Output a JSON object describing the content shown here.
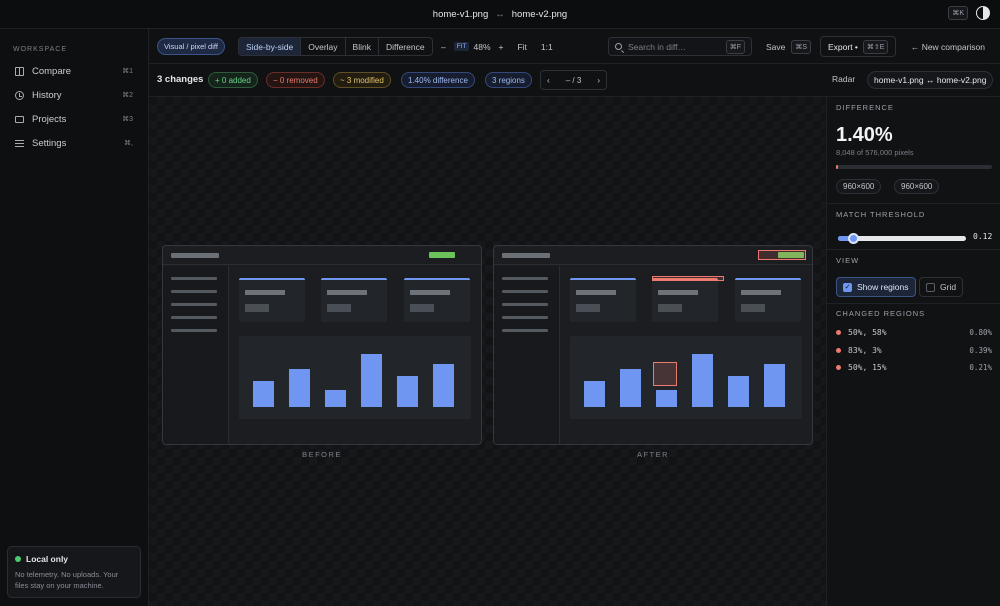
{
  "titlebar": {
    "file_a": "home-v1.png",
    "arrow": "↔",
    "file_b": "home-v2.png",
    "shortcut": "⌘K"
  },
  "sidebar": {
    "section": "WORKSPACE",
    "items": [
      {
        "label": "Compare",
        "shortcut": "⌘1",
        "icon": "compare-icon"
      },
      {
        "label": "History",
        "shortcut": "⌘2",
        "icon": "clock-icon"
      },
      {
        "label": "Projects",
        "shortcut": "⌘3",
        "icon": "folder-icon"
      },
      {
        "label": "Settings",
        "shortcut": "⌘,",
        "icon": "sliders-icon"
      }
    ],
    "local": {
      "title": "Local only",
      "body": "No telemetry. No uploads. Your files stay on your machine."
    }
  },
  "toolbar": {
    "mode": "Visual / pixel diff",
    "views": [
      "Side-by-side",
      "Overlay",
      "Blink",
      "Difference"
    ],
    "active_view": "Side-by-side",
    "zoom_out": "–",
    "fit_badge": "FIT",
    "zoom": "48%",
    "zoom_in": "+",
    "fit": "Fit",
    "one_to_one": "1:1",
    "search_placeholder": "Search in diff…",
    "search_shortcut": "⌘F",
    "save": "Save",
    "save_shortcut": "⌘S",
    "export": "Export •",
    "export_shortcut": "⌘⇧E",
    "new_comparison": "← New comparison"
  },
  "summary": {
    "changes": "3 changes",
    "added": "+ 0 added",
    "removed": "− 0 removed",
    "modified": "~ 3 modified",
    "difference": "1.40% difference",
    "regions": "3 regions",
    "pager_prev": "‹",
    "pager_text": "–  /  3",
    "pager_next": "›",
    "radar": "Radar",
    "files": "home-v1.png ↔ home-v2.png"
  },
  "canvas": {
    "before_label": "BEFORE",
    "after_label": "AFTER",
    "chart_bar_levels": [
      0.42,
      0.62,
      0.28,
      0.85,
      0.5,
      0.7
    ]
  },
  "panel": {
    "difference_title": "DIFFERENCE",
    "difference_pct": "1.40%",
    "pixels": "8,048 of 576,000 pixels",
    "diff_fraction": 0.014,
    "dim_a": "960×600",
    "dim_b": "960×600",
    "threshold_title": "MATCH THRESHOLD",
    "threshold_value": "0.12",
    "threshold_fraction": 0.12,
    "view_title": "VIEW",
    "show_regions": "Show regions",
    "grid": "Grid",
    "regions_title": "CHANGED REGIONS",
    "regions": [
      {
        "pos": "50%, 58%",
        "pct": "0.80%"
      },
      {
        "pos": "83%, 3%",
        "pct": "0.39%"
      },
      {
        "pos": "50%, 15%",
        "pct": "0.21%"
      }
    ]
  }
}
